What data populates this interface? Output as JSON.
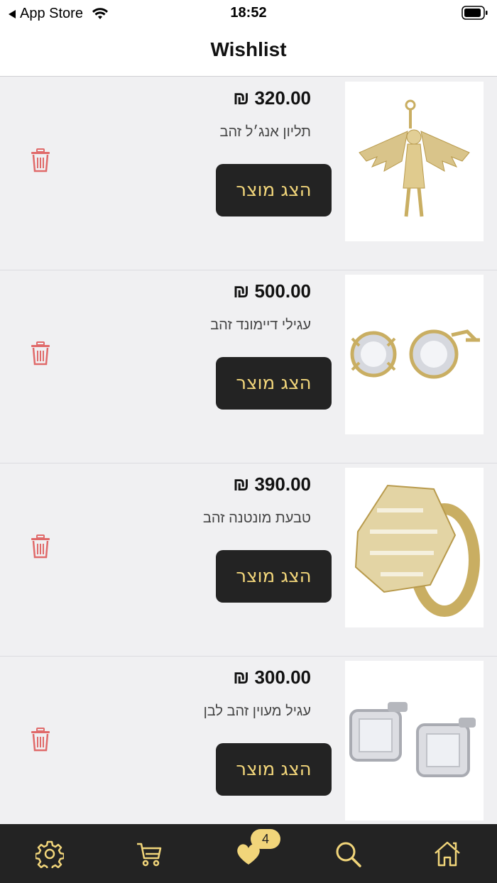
{
  "status_bar": {
    "back_label": "App Store",
    "time": "18:52"
  },
  "header": {
    "title": "Wishlist"
  },
  "items": [
    {
      "price": "₪ 320.00",
      "name": "תליון אנג׳ל זהב",
      "button_label": "הצג מוצר",
      "image_icon": "angel-pendant"
    },
    {
      "price": "₪ 500.00",
      "name": "עגילי דיימונד זהב",
      "button_label": "הצג מוצר",
      "image_icon": "diamond-earrings"
    },
    {
      "price": "₪ 390.00",
      "name": "טבעת מונטנה זהב",
      "button_label": "הצג מוצר",
      "image_icon": "gold-ring"
    },
    {
      "price": "₪ 300.00",
      "name": "עגיל מעוין זהב לבן",
      "button_label": "הצג מוצר",
      "image_icon": "square-earrings"
    }
  ],
  "tab_bar": {
    "items": [
      "settings",
      "cart",
      "wishlist",
      "search",
      "home"
    ],
    "wishlist_badge": "4"
  },
  "colors": {
    "accent": "#f1d57a",
    "dark": "#232323",
    "delete": "#e06a6a",
    "background": "#f0f0f2"
  }
}
